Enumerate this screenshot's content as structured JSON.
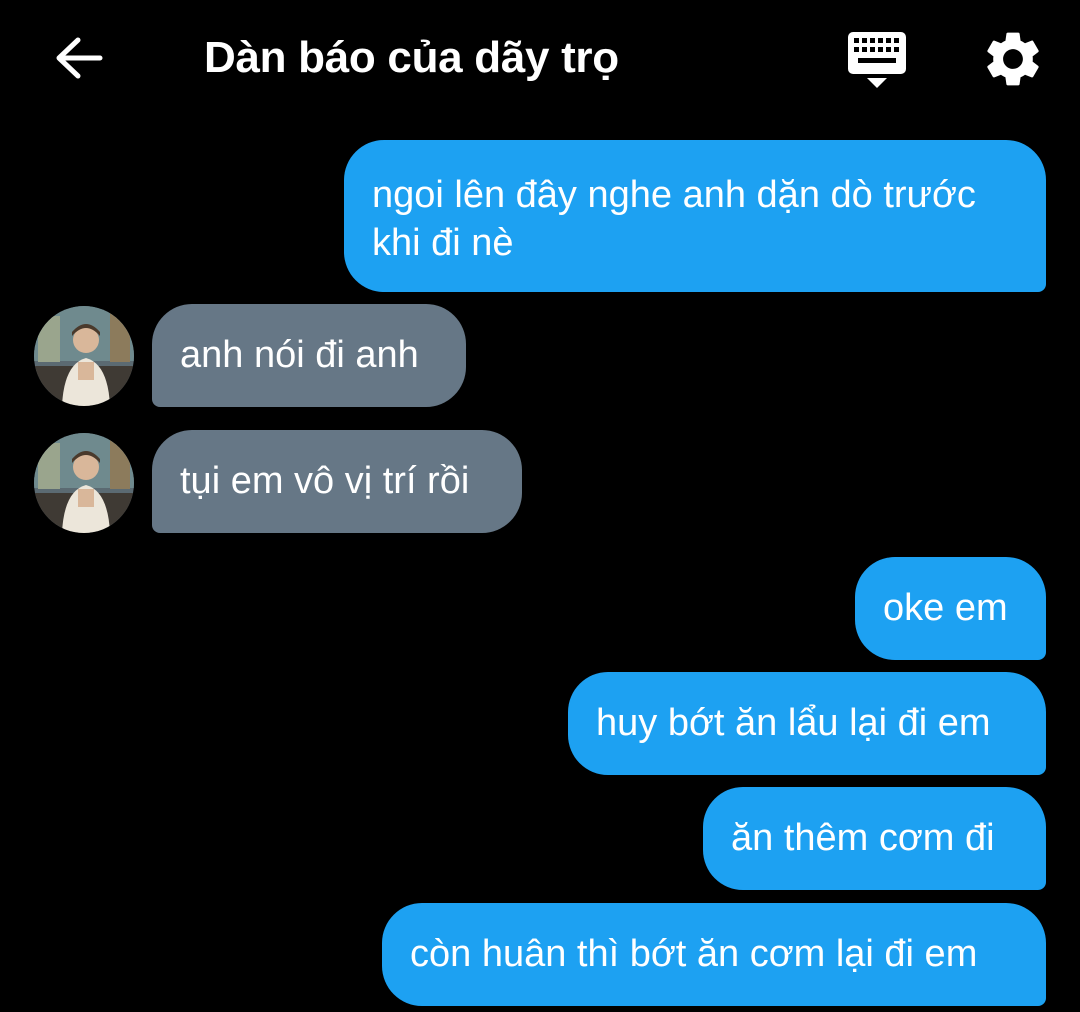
{
  "header": {
    "title": "Dàn báo của dãy trọ",
    "back_icon": "back-arrow-icon",
    "keyboard_icon": "keyboard-icon",
    "settings_icon": "gear-icon"
  },
  "colors": {
    "background": "#000000",
    "outgoing_bubble": "#1da1f2",
    "incoming_bubble": "#667786",
    "text": "#ffffff"
  },
  "messages": [
    {
      "sender": "me",
      "line1": "ngoi lên đây nghe anh dặn dò trước",
      "line2": "khi đi nè"
    },
    {
      "sender": "them",
      "text": "anh nói đi anh"
    },
    {
      "sender": "them",
      "text": "tụi em vô vị trí rồi"
    },
    {
      "sender": "me",
      "text": "oke em"
    },
    {
      "sender": "me",
      "text": "huy bớt ăn lẩu lại đi em"
    },
    {
      "sender": "me",
      "text": "ăn thêm cơm đi"
    },
    {
      "sender": "me",
      "text": "còn huân thì bớt ăn cơm lại đi em"
    }
  ]
}
